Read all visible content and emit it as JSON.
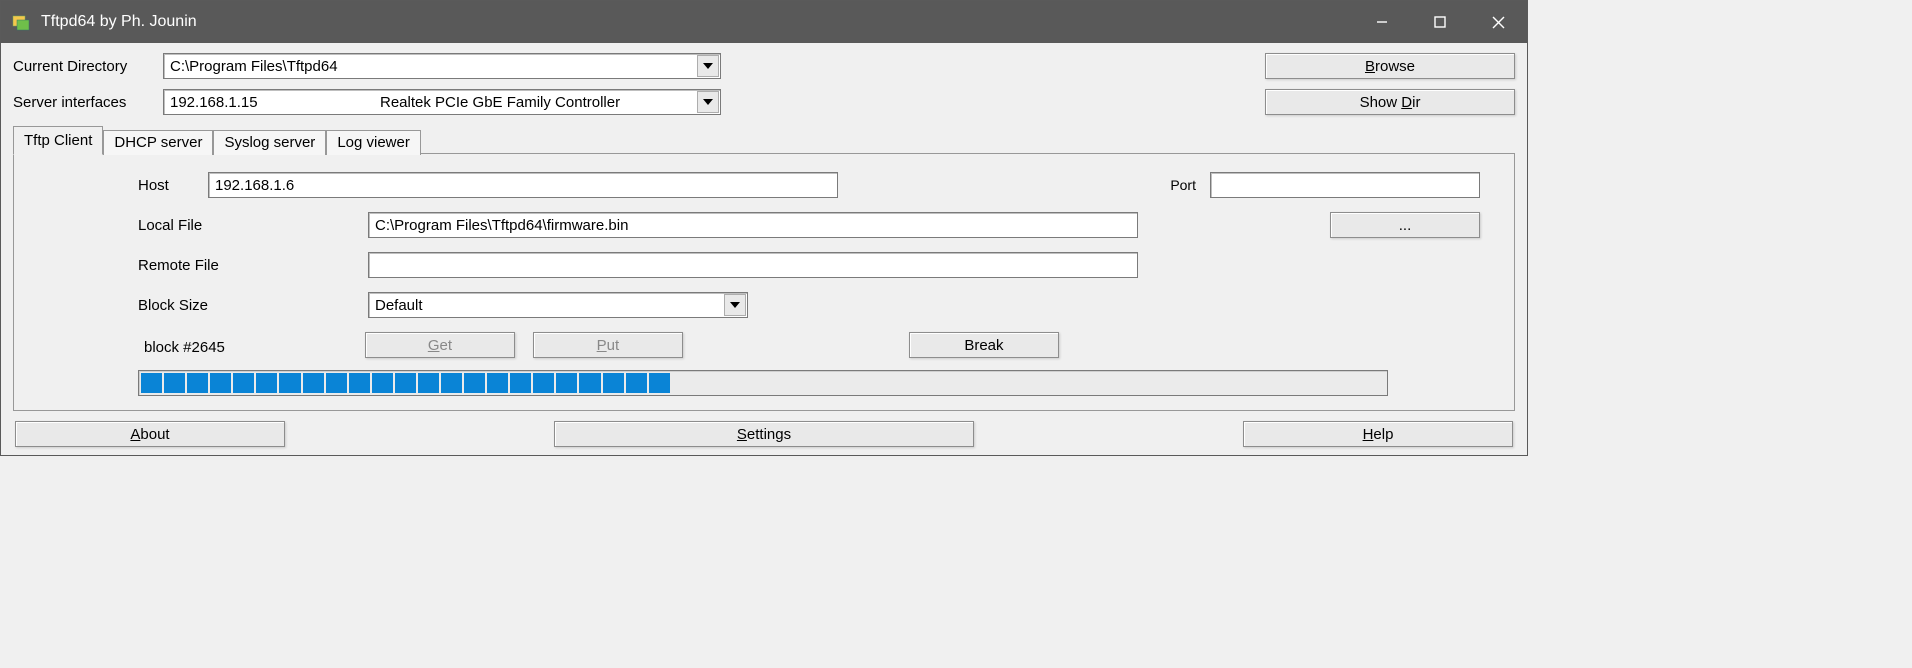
{
  "window": {
    "title": "Tftpd64 by Ph. Jounin"
  },
  "top": {
    "current_directory_label": "Current Directory",
    "current_directory_value": "C:\\Program Files\\Tftpd64",
    "server_interfaces_label": "Server interfaces",
    "server_interfaces_ip": "192.168.1.15",
    "server_interfaces_adapter": "Realtek PCIe GbE Family Controller",
    "browse_btn": "Browse",
    "show_dir_btn": "Show Dir"
  },
  "tabs": {
    "items": [
      "Tftp Client",
      "DHCP server",
      "Syslog server",
      "Log viewer"
    ],
    "active": 0
  },
  "client": {
    "host_label": "Host",
    "host_value": "192.168.1.6",
    "port_label": "Port",
    "port_value": "",
    "local_file_label": "Local File",
    "local_file_value": "C:\\Program Files\\Tftpd64\\firmware.bin",
    "remote_file_label": "Remote File",
    "remote_file_value": "",
    "block_size_label": "Block Size",
    "block_size_value": "Default",
    "browse_ellipsis": "...",
    "get_btn": "Get",
    "put_btn": "Put",
    "break_btn": "Break",
    "status_text": "block #2645",
    "progress_filled_segments": 23,
    "progress_total_segments": 54
  },
  "footer": {
    "about_btn": "About",
    "settings_btn": "Settings",
    "help_btn": "Help"
  }
}
